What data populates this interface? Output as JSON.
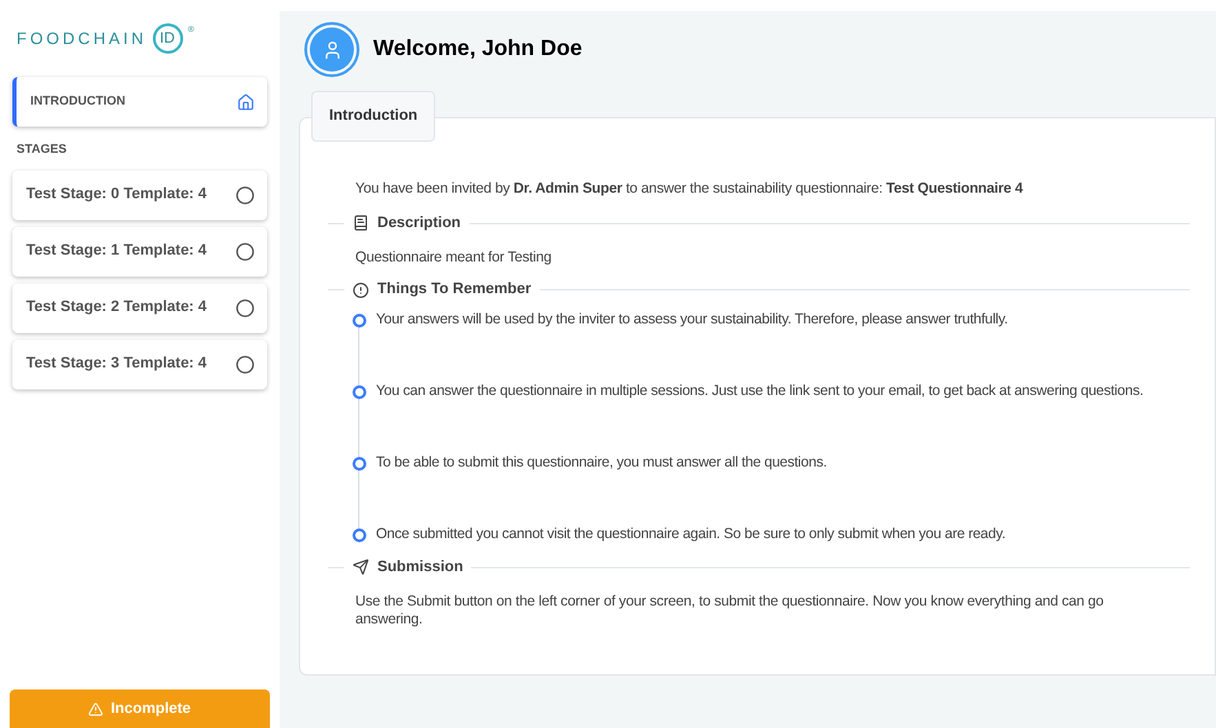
{
  "logo": {
    "text": "FOODCHAIN",
    "badge": "ID",
    "mark": "®"
  },
  "sidebar": {
    "intro": {
      "label": "INTRODUCTION",
      "selected": true
    },
    "stages_heading": "STAGES",
    "stages": [
      {
        "label": "Test Stage: 0 Template: 4",
        "selected": false,
        "completed": false
      },
      {
        "label": "Test Stage: 1 Template: 4",
        "selected": false,
        "completed": false
      },
      {
        "label": "Test Stage: 2 Template: 4",
        "selected": false,
        "completed": false
      },
      {
        "label": "Test Stage: 3 Template: 4",
        "selected": false,
        "completed": false
      }
    ],
    "status_button": "Incomplete"
  },
  "header": {
    "title": "Welcome, John Doe"
  },
  "tabs": [
    {
      "label": "Introduction",
      "selected": true
    }
  ],
  "content": {
    "invite": "You have been invited by **Dr. Admin Super** to answer the sustainability questionnaire: **Test Questionnaire 4**",
    "sections": [
      {
        "kind": "text",
        "title": "Description",
        "text": "Questionnaire meant for Testing"
      },
      {
        "kind": "timeline",
        "title": "Things To Remember",
        "items": [
          "Your answers will be used by the inviter to assess your sustainability. Therefore, please answer truthfully.",
          "You can answer the questionnaire in multiple sessions. Just use the link sent to your email, to get back at answering questions.",
          "To be able to submit this questionnaire, you must answer all the questions.",
          "Once submitted you cannot visit the questionnaire again. So be sure to only submit when you are ready."
        ]
      },
      {
        "kind": "text",
        "title": "Submission",
        "text": "Use the Submit button on the left corner of your screen, to submit the questionnaire. Now you know everything and can go answering."
      }
    ]
  }
}
